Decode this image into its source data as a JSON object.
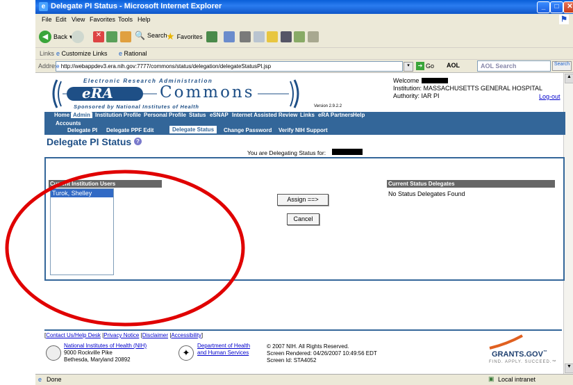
{
  "window": {
    "title": "Delegate PI Status - Microsoft Internet Explorer",
    "menu": [
      "File",
      "Edit",
      "View",
      "Favorites",
      "Tools",
      "Help"
    ]
  },
  "toolbar": {
    "back": "Back",
    "search": "Search",
    "favorites": "Favorites"
  },
  "linksbar": {
    "label": "Links",
    "items": [
      "Customize Links",
      "Rational"
    ]
  },
  "addressbar": {
    "label": "Address",
    "url": "http://webappdev3.era.nih.gov:7777/commons/status/delegation/delegateStatusPI.jsp",
    "go": "Go",
    "aol": "AOL",
    "aol_search": "AOL Search",
    "search_btn": "Search"
  },
  "era": {
    "top_text": "Electronic Research Administration",
    "era": "eRA",
    "commons": "Commons",
    "sponsored": "Sponsored by National Institutes of Health",
    "version": "Version 2.9.2.2",
    "welcome": "Welcome",
    "institution": "Institution: MASSACHUSETTS GENERAL HOSPITAL",
    "authority": "Authority:  IAR PI",
    "logout": "Log-out"
  },
  "nav": {
    "main": [
      "Home",
      "Admin",
      "Institution Profile",
      "Personal Profile",
      "Status",
      "eSNAP",
      "Internet Assisted Review",
      "Links",
      "eRA Partners",
      "Help"
    ],
    "accounts": "Accounts",
    "sub": [
      "Delegate PI",
      "Delegate PPF Edit",
      "Delegate Status",
      "Change Password",
      "Verify NIH Support"
    ]
  },
  "page": {
    "title": "Delegate PI Status",
    "delegating_text": "You are Delegating Status for:"
  },
  "left_panel": {
    "header": "Current Institution Users",
    "users": [
      "Turok, Shelley"
    ]
  },
  "buttons": {
    "assign": "Assign ==>",
    "cancel": "Cancel"
  },
  "right_panel": {
    "header": "Current Status Delegates",
    "empty": "No Status Delegates Found"
  },
  "footer": {
    "links": [
      "Contact Us/Help Desk",
      "Privacy Notice",
      "Disclaimer",
      "Accessibility"
    ],
    "nih_link": "National Institutes of Health (NIH)",
    "nih_addr1": "9000 Rockville Pike",
    "nih_addr2": "Bethesda, Maryland 20892",
    "hhs_link1": "Department of Health",
    "hhs_link2": "and Human Services",
    "copyright": "© 2007 NIH. All Rights Reserved.",
    "rendered": "Screen Rendered: 04/26/2007 10:49:56 EDT",
    "screen_id": "Screen Id: STA4052",
    "grants": "GRANTS.GOV",
    "grants_tm": "™",
    "grants_tag": "FIND. APPLY. SUCCEED.™"
  },
  "status": {
    "left": "Done",
    "right": "Local intranet"
  },
  "colors": {
    "nav": "#336699",
    "annotation": "#e00000",
    "title_blue": "#1e4f86"
  }
}
